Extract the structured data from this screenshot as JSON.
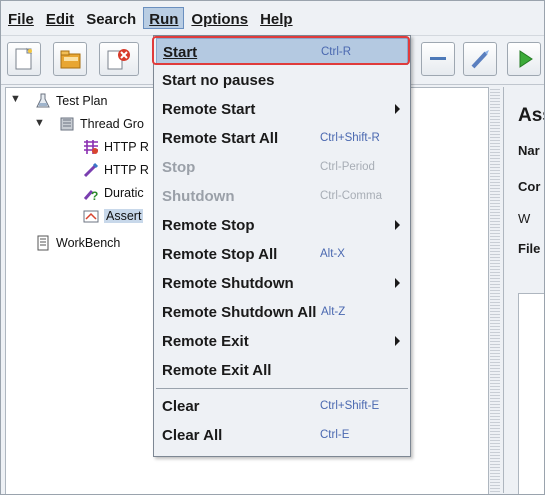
{
  "menubar": {
    "file": "File",
    "edit": "Edit",
    "search": "Search",
    "run": "Run",
    "options": "Options",
    "help": "Help"
  },
  "tree": {
    "test_plan": "Test Plan",
    "thread_group": "Thread Gro",
    "http1": "HTTP R",
    "http2": "HTTP R",
    "duration": "Duratic",
    "assert": "Assert",
    "workbench": "WorkBench"
  },
  "right_panel": {
    "title": "Ass",
    "name": "Nar",
    "comments": "Cor",
    "w": "W",
    "file": "File"
  },
  "run_menu": {
    "start": {
      "label": "Start",
      "accel": "Ctrl-R"
    },
    "start_no_pauses": {
      "label": "Start no pauses"
    },
    "remote_start": {
      "label": "Remote Start"
    },
    "remote_start_all": {
      "label": "Remote Start All",
      "accel": "Ctrl+Shift-R"
    },
    "stop": {
      "label": "Stop",
      "accel": "Ctrl-Period"
    },
    "shutdown": {
      "label": "Shutdown",
      "accel": "Ctrl-Comma"
    },
    "remote_stop": {
      "label": "Remote Stop"
    },
    "remote_stop_all": {
      "label": "Remote Stop All",
      "accel": "Alt-X"
    },
    "remote_shutdown": {
      "label": "Remote Shutdown"
    },
    "remote_shutdown_all": {
      "label": "Remote Shutdown All",
      "accel": "Alt-Z"
    },
    "remote_exit": {
      "label": "Remote Exit"
    },
    "remote_exit_all": {
      "label": "Remote Exit All"
    },
    "clear": {
      "label": "Clear",
      "accel": "Ctrl+Shift-E"
    },
    "clear_all": {
      "label": "Clear All",
      "accel": "Ctrl-E"
    }
  },
  "colors": {
    "highlight": "#b4c9e1",
    "accelerator": "#4a68b0",
    "annotation": "#e03b3b",
    "disabled": "#9aa0a8"
  },
  "icons": [
    "new-file-icon",
    "open-folder-icon",
    "close-icon",
    "minus-icon",
    "wand-icon",
    "run-icon",
    "test-plan-icon",
    "thread-group-icon",
    "http-request-icon",
    "duration-assertion-icon",
    "assertion-icon",
    "workbench-icon",
    "submenu-arrow-icon"
  ]
}
